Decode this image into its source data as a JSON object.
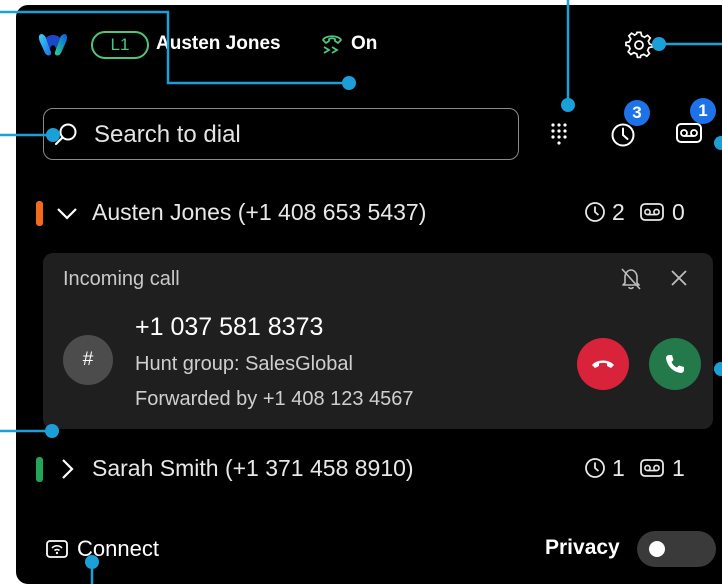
{
  "header": {
    "logo_icon": "webex-logo",
    "line_label": "L1",
    "user_name": "Austen Jones",
    "dnd_icon": "call-forward-icon",
    "dnd_status": "On",
    "settings_icon": "gear-icon"
  },
  "search": {
    "placeholder": "Search to dial"
  },
  "toolbar": {
    "dialpad_icon": "dialpad-icon",
    "history_icon": "history-icon",
    "history_badge": "3",
    "voicemail_icon": "voicemail-icon",
    "voicemail_badge": "1"
  },
  "lines": [
    {
      "name": "Austen Jones (+1 408 653 5437)",
      "color": "#f26b1d",
      "expanded": true,
      "missed_calls": "2",
      "voicemails": "0"
    },
    {
      "name": "Sarah Smith (+1 371 458 8910)",
      "color": "#24a35a",
      "expanded": false,
      "missed_calls": "1",
      "voicemails": "1"
    }
  ],
  "incoming_call": {
    "title": "Incoming call",
    "avatar_text": "#",
    "number": "+1 037 581 8373",
    "hunt_group": "Hunt group: SalesGlobal",
    "forwarded_by": "Forwarded by +1 408 123 4567",
    "decline_color": "#d9233b",
    "answer_color": "#24794a"
  },
  "footer": {
    "connect_label": "Connect",
    "privacy_label": "Privacy",
    "privacy_enabled": false
  },
  "colors": {
    "accent_blue": "#1d72e8",
    "callout_blue": "#1a9fd6",
    "status_green": "#4ec57c",
    "background": "#000000"
  }
}
